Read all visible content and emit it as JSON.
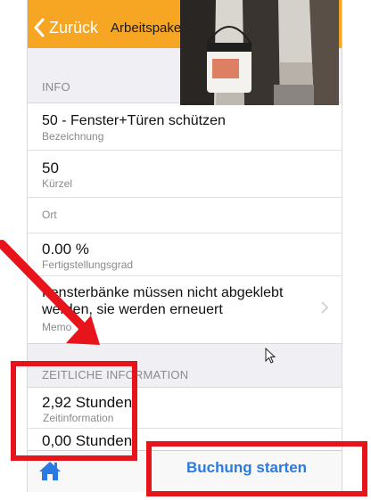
{
  "nav": {
    "back_label": "Zurück",
    "title": "Arbeitspake"
  },
  "info": {
    "header": "INFO",
    "rows": [
      {
        "value": "50 - Fenster+Türen schützen",
        "label": "Bezeichnung"
      },
      {
        "value": "50",
        "label": "Kürzel"
      },
      {
        "value": "",
        "label": "Ort"
      },
      {
        "value": "0.00 %",
        "label": "Fertigstellungsgrad"
      },
      {
        "value_line1": "Fensterbänke müssen nicht abgeklebt",
        "value_line2": "werden, sie werden erneuert",
        "label": "Memo"
      }
    ]
  },
  "time": {
    "header": "ZEITLICHE INFORMATION",
    "rows": [
      {
        "value": "2,92 Stunden",
        "label": "Zeitinformation"
      },
      {
        "value": "0,00 Stunden"
      }
    ]
  },
  "tabbar": {
    "booking_label": "Buchung starten"
  },
  "colors": {
    "accent": "#f7a623",
    "link": "#2a7ae2",
    "annotation": "#e8141c"
  },
  "icons": {
    "back": "chevron-left-icon",
    "home": "home-icon",
    "disclosure": "chevron-right-icon"
  }
}
